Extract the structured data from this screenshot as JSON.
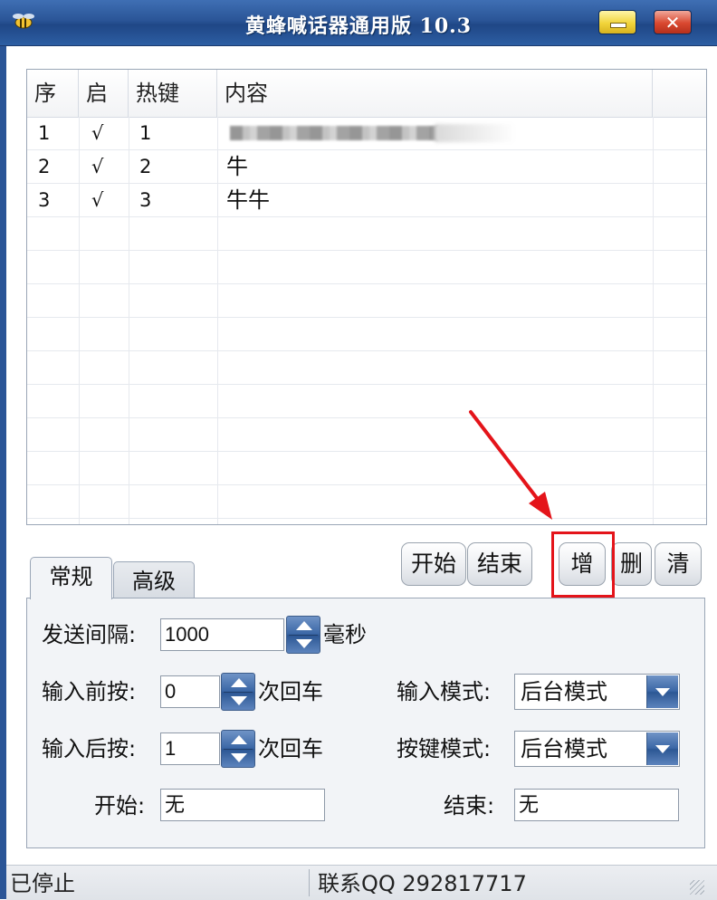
{
  "window": {
    "title": "黄蜂喊话器通用版 10.3",
    "minimize_label": "",
    "close_label": "✕"
  },
  "list": {
    "columns": [
      "序",
      "启",
      "热键",
      "内容",
      ""
    ],
    "rows": [
      {
        "index": "1",
        "enabled": "√",
        "hotkey": "1",
        "content": "",
        "content_blurred": true
      },
      {
        "index": "2",
        "enabled": "√",
        "hotkey": "2",
        "content": "牛",
        "content_blurred": false
      },
      {
        "index": "3",
        "enabled": "√",
        "hotkey": "3",
        "content": "牛牛",
        "content_blurred": false
      }
    ]
  },
  "buttons": {
    "start": "开始",
    "end": "结束",
    "add": "增",
    "delete": "删",
    "clear": "清"
  },
  "tabs": [
    "常规",
    "高级"
  ],
  "general": {
    "interval_label": "发送间隔:",
    "interval_value": "1000",
    "interval_unit": "毫秒",
    "before_label": "输入前按:",
    "before_value": "0",
    "before_unit": "次回车",
    "after_label": "输入后按:",
    "after_value": "1",
    "after_unit": "次回车",
    "input_mode_label": "输入模式:",
    "input_mode_value": "后台模式",
    "key_mode_label": "按键模式:",
    "key_mode_value": "后台模式",
    "start_label": "开始:",
    "start_value": "无",
    "end_label": "结束:",
    "end_value": "无"
  },
  "status": {
    "state": "已停止",
    "contact": "联系QQ 292817717"
  },
  "colors": {
    "titlebar": "#2a5597",
    "highlight": "#e4141a",
    "spin_button": "#3b67a6"
  }
}
